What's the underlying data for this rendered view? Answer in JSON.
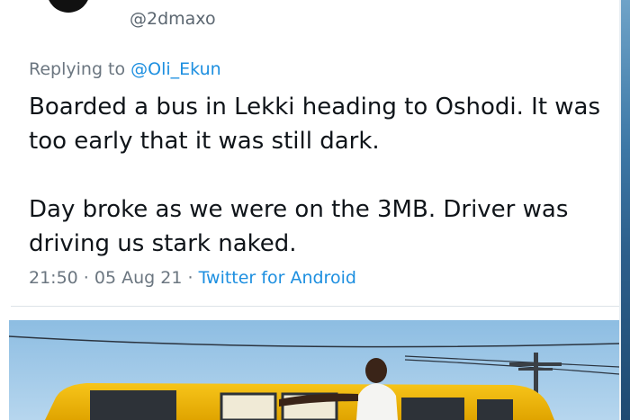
{
  "tweet": {
    "handle": "@2dmaxo",
    "replying_prefix": "Replying to ",
    "replying_to": "@Oli_Ekun",
    "paragraphs": [
      "Boarded a bus in Lekki heading to Oshodi. It was too early that it was still dark.",
      "Day broke as we were on the 3MB. Driver was driving us stark naked."
    ],
    "time": "21:50",
    "date": "05 Aug 21",
    "separator": " · ",
    "client": "Twitter for Android"
  },
  "colors": {
    "text": "#0f1419",
    "secondary": "#6b7680",
    "link": "#1d8fe0",
    "bus_yellow": "#f2b705",
    "sky": "#9cc6e6"
  }
}
